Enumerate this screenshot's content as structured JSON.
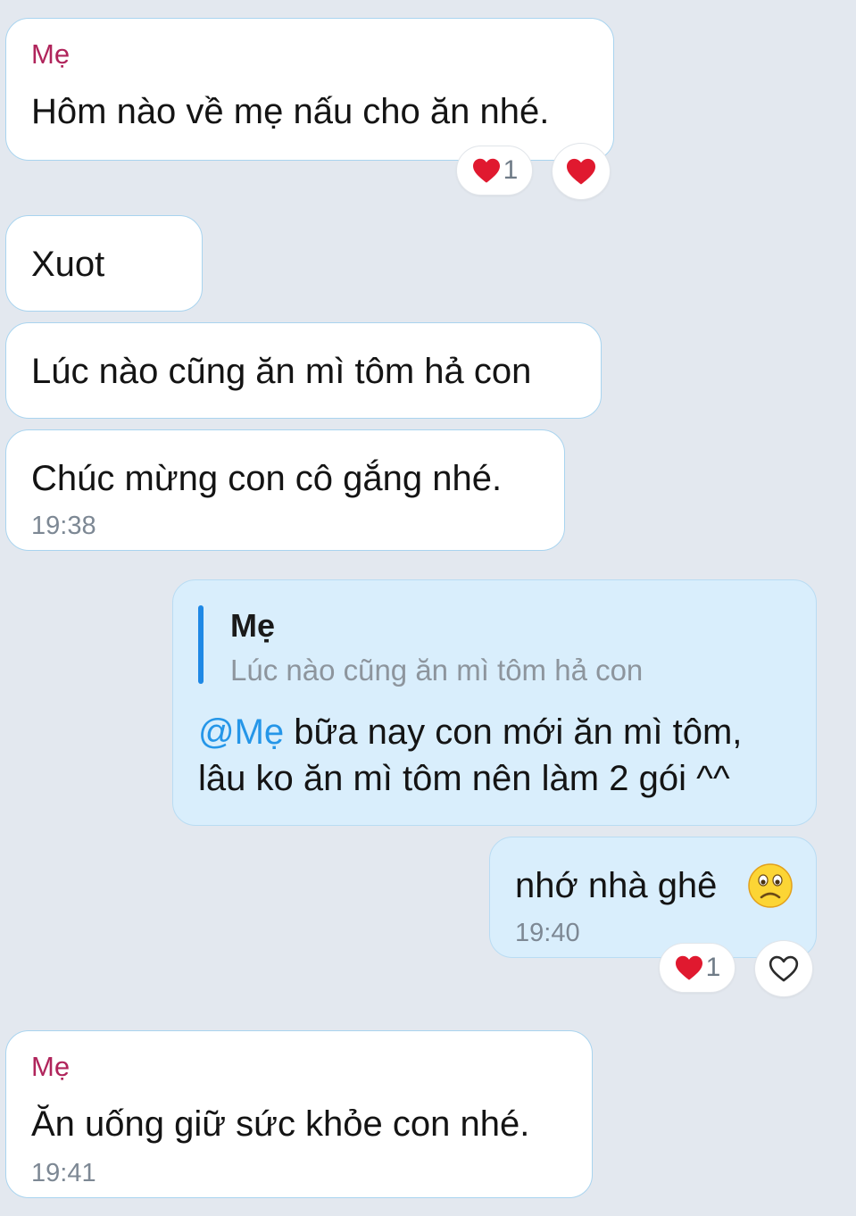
{
  "messages": {
    "m1": {
      "sender": "Mẹ",
      "text": "Hôm nào về mẹ nấu cho ăn nhé.",
      "reaction_count": "1"
    },
    "m2": {
      "text": "Xuot"
    },
    "m3": {
      "text": "Lúc nào cũng ăn mì tôm hả con"
    },
    "m4": {
      "text": "Chúc mừng con cô gắng nhé.",
      "time": "19:38"
    },
    "m5": {
      "quote_name": "Mẹ",
      "quote_text": "Lúc nào cũng ăn mì tôm hả con",
      "mention": "@Mẹ",
      "line1_rest": " bữa nay con mới ăn mì tôm,",
      "line2": "lâu ko ăn mì tôm nên làm 2 gói ^^"
    },
    "m6": {
      "text": "nhớ nhà ghê",
      "emoji": "sad-face-emoji",
      "time": "19:40",
      "reaction_count": "1"
    },
    "m7": {
      "sender": "Mẹ",
      "text": "Ăn uống giữ sức khỏe con nhé.",
      "time": "19:41"
    }
  },
  "icons": {
    "heart": "heart-icon",
    "heart_outline": "heart-outline-icon"
  },
  "colors": {
    "background": "#e3e8ef",
    "incoming_bubble": "#ffffff",
    "outgoing_bubble": "#d9eefc",
    "sender_name": "#b0245b",
    "mention": "#2596e8",
    "quote_bar": "#1e88e5",
    "heart": "#e0192f",
    "timestamp": "#7d8894"
  }
}
